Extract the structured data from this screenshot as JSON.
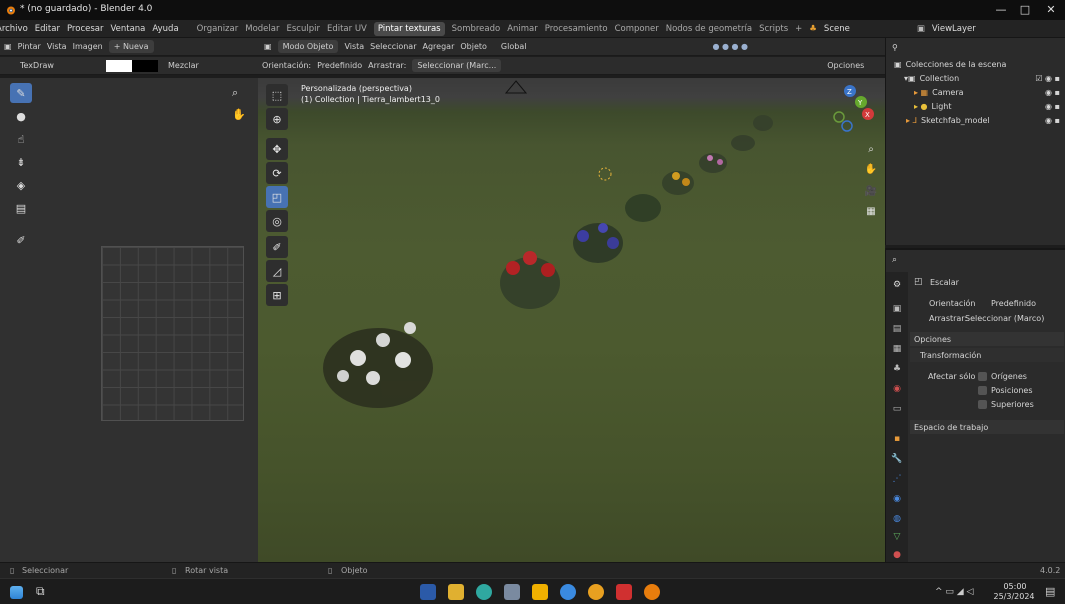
{
  "title_bar": {
    "title": "* (no guardado) - Blender 4.0",
    "minimize": "—",
    "maximize": "□",
    "close": "✕"
  },
  "menu": {
    "items": [
      "Archivo",
      "Editar",
      "Procesar",
      "Ventana",
      "Ayuda"
    ],
    "workspaces": [
      "Organizar",
      "Modelar",
      "Esculpir",
      "Editar UV",
      "Pintar texturas",
      "Sombreado",
      "Animar",
      "Procesamiento",
      "Componer",
      "Nodos de geometría",
      "Scripts",
      "+"
    ],
    "active_workspace": "Pintar texturas",
    "scene": "Scene",
    "view_layer": "ViewLayer"
  },
  "image_editor_header": {
    "mode": "Pintar",
    "view": "Vista",
    "image": "Imagen",
    "new": "+ Nueva"
  },
  "image_tool_settings": {
    "brush": "TexDraw",
    "blend": "Mezclar"
  },
  "viewport_header": {
    "mode": "Modo Objeto",
    "menus": [
      "Vista",
      "Seleccionar",
      "Agregar",
      "Objeto"
    ],
    "orientation_global": "Global",
    "orientation_label": "Orientación:",
    "orientation_value": "Predefinido",
    "drag_label": "Arrastrar:",
    "drag_value": "Seleccionar (Marc...",
    "options": "Opciones"
  },
  "viewport": {
    "info_line1": "Personalizada (perspectiva)",
    "info_line2": "(1) Collection | Tierra_lambert13_0"
  },
  "outliner": {
    "header": "Colecciones de la escena",
    "rows": [
      {
        "name": "Collection"
      },
      {
        "name": "Camera"
      },
      {
        "name": "Light"
      },
      {
        "name": "Sketchfab_model"
      }
    ]
  },
  "properties": {
    "tool_name": "Escalar",
    "orientation_label": "Orientación",
    "orientation_value": "Predefinido",
    "drag_label": "Arrastrar:",
    "drag_value": "Seleccionar (Marco)",
    "options": "Opciones",
    "transform": "Transformación",
    "affect_only": "Afectar sólo",
    "checkboxes": [
      "Orígenes",
      "Posiciones",
      "Superiores"
    ],
    "workspace": "Espacio de trabajo"
  },
  "status_bar": {
    "select": "Seleccionar",
    "rotate": "Rotar vista",
    "object": "Objeto",
    "version": "4.0.2"
  },
  "taskbar": {
    "time": "05:00",
    "date": "25/3/2024"
  }
}
